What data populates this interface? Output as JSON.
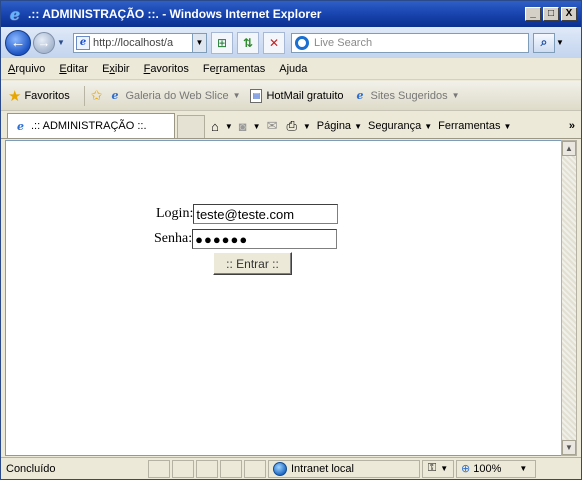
{
  "window": {
    "title": ".:: ADMINISTRAÇÃO ::. - Windows Internet Explorer",
    "controls": {
      "minimize": "_",
      "maximize": "□",
      "close": "X"
    }
  },
  "addressbar": {
    "url": "http://localhost/a",
    "search_placeholder": "Live Search"
  },
  "menubar": {
    "items": [
      {
        "label": "Arquivo",
        "accel": "A",
        "rest": "rquivo"
      },
      {
        "label": "Editar",
        "accel": "E",
        "rest": "ditar"
      },
      {
        "label": "Exibir",
        "prefix": "E",
        "accel": "x",
        "rest": "ibir"
      },
      {
        "label": "Favoritos",
        "accel": "F",
        "rest": "avoritos"
      },
      {
        "label": "Ferramentas",
        "prefix": "Fe",
        "accel": "r",
        "rest": "ramentas"
      },
      {
        "label": "Ajuda",
        "prefix": "A",
        "accel": "j",
        "rest": "uda"
      }
    ]
  },
  "favorites": {
    "label": "Favoritos",
    "links": [
      {
        "label": "Galeria do Web Slice",
        "has_dropdown": true,
        "dim": true
      },
      {
        "label": "HotMail gratuito",
        "has_dropdown": false,
        "dim": false
      },
      {
        "label": "Sites Sugeridos",
        "has_dropdown": true,
        "dim": true
      }
    ]
  },
  "tabbar": {
    "tab_label": ".:: ADMINISTRAÇÃO ::.",
    "commands": {
      "page": "Página",
      "security": "Segurança",
      "tools": "Ferramentas"
    },
    "more": "»"
  },
  "form": {
    "login_label": "Login:",
    "login_value": "teste@teste.com",
    "password_label": "Senha:",
    "password_mask": "●●●●●●",
    "submit_label": ":: Entrar ::"
  },
  "statusbar": {
    "status": "Concluído",
    "zone": "Intranet local",
    "zoom": "100%"
  },
  "colors": {
    "titlebar": "#0a2f8f",
    "chrome": "#ece9d8",
    "content_bg": "#ffffff"
  }
}
